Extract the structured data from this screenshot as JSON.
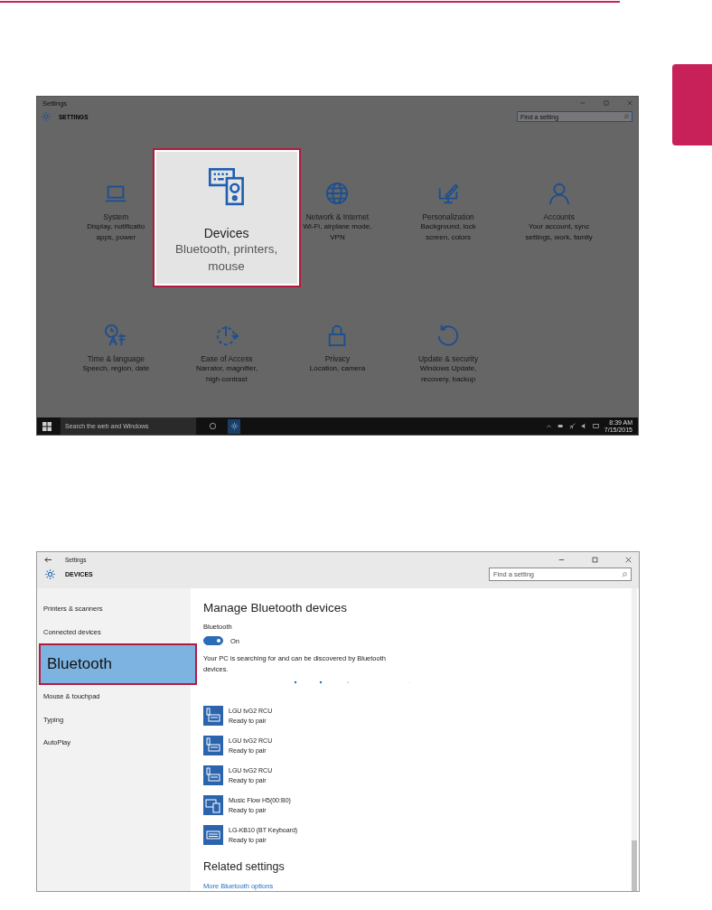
{
  "settings_home": {
    "window": {
      "title": "Settings"
    },
    "header": "SETTINGS",
    "search": {
      "placeholder": "Find a setting"
    },
    "tiles": [
      {
        "kind": "system",
        "title": "System",
        "lines": [
          "Display, notificatio",
          "apps, power"
        ],
        "selected": false
      },
      {
        "kind": "devices",
        "title": "Devices",
        "lines": [
          "Bluetooth, printers,",
          "mouse"
        ],
        "selected": true
      },
      {
        "kind": "network",
        "title": "Network & Internet",
        "lines": [
          "Wi-Fi, airplane mode,",
          "VPN"
        ],
        "selected": false
      },
      {
        "kind": "personalization",
        "title": "Personalization",
        "lines": [
          "Background, lock",
          "screen, colors"
        ],
        "selected": false
      },
      {
        "kind": "accounts",
        "title": "Accounts",
        "lines": [
          "Your account, sync",
          "settings, work, family"
        ],
        "selected": false
      },
      {
        "kind": "time",
        "title": "Time & language",
        "lines": [
          "Speech, region, date"
        ],
        "selected": false
      },
      {
        "kind": "ease",
        "title": "Ease of Access",
        "lines": [
          "Narrator, magnifier,",
          "high contrast"
        ],
        "selected": false
      },
      {
        "kind": "privacy",
        "title": "Privacy",
        "lines": [
          "Location, camera"
        ],
        "selected": false
      },
      {
        "kind": "update",
        "title": "Update & security",
        "lines": [
          "Windows Update,",
          "recovery, backup"
        ],
        "selected": false
      }
    ],
    "taskbar": {
      "search_placeholder": "Search the web and Windows",
      "time": "8:39 AM",
      "date": "7/15/2015"
    }
  },
  "devices": {
    "window": {
      "title": "Settings"
    },
    "header": "DEVICES",
    "search": {
      "placeholder": "Find a setting"
    },
    "sidebar": [
      {
        "label": "Printers & scanners",
        "selected": false
      },
      {
        "label": "Connected devices",
        "selected": false
      },
      {
        "label": "Bluetooth",
        "selected": true
      },
      {
        "label": "Mouse & touchpad",
        "selected": false
      },
      {
        "label": "Typing",
        "selected": false
      },
      {
        "label": "AutoPlay",
        "selected": false
      }
    ],
    "content": {
      "title": "Manage Bluetooth devices",
      "toggle_label": "Bluetooth",
      "toggle": {
        "on": true,
        "label": "On"
      },
      "description": "Your PC is searching for and can be discovered by Bluetooth devices.",
      "device_list": [
        {
          "kind": "remote",
          "name": "LGU tvG2 RCU",
          "status": "Ready to pair"
        },
        {
          "kind": "remote",
          "name": "LGU tvG2 RCU",
          "status": "Ready to pair"
        },
        {
          "kind": "remote",
          "name": "LGU tvG2 RCU",
          "status": "Ready to pair"
        },
        {
          "kind": "speaker",
          "name": "Music Flow H5(00:B0)",
          "status": "Ready to pair"
        },
        {
          "kind": "keyboard",
          "name": "LG-KB10 (BT Keyboard)",
          "status": "Ready to pair"
        }
      ],
      "related_title": "Related settings",
      "link": "More Bluetooth options"
    }
  }
}
